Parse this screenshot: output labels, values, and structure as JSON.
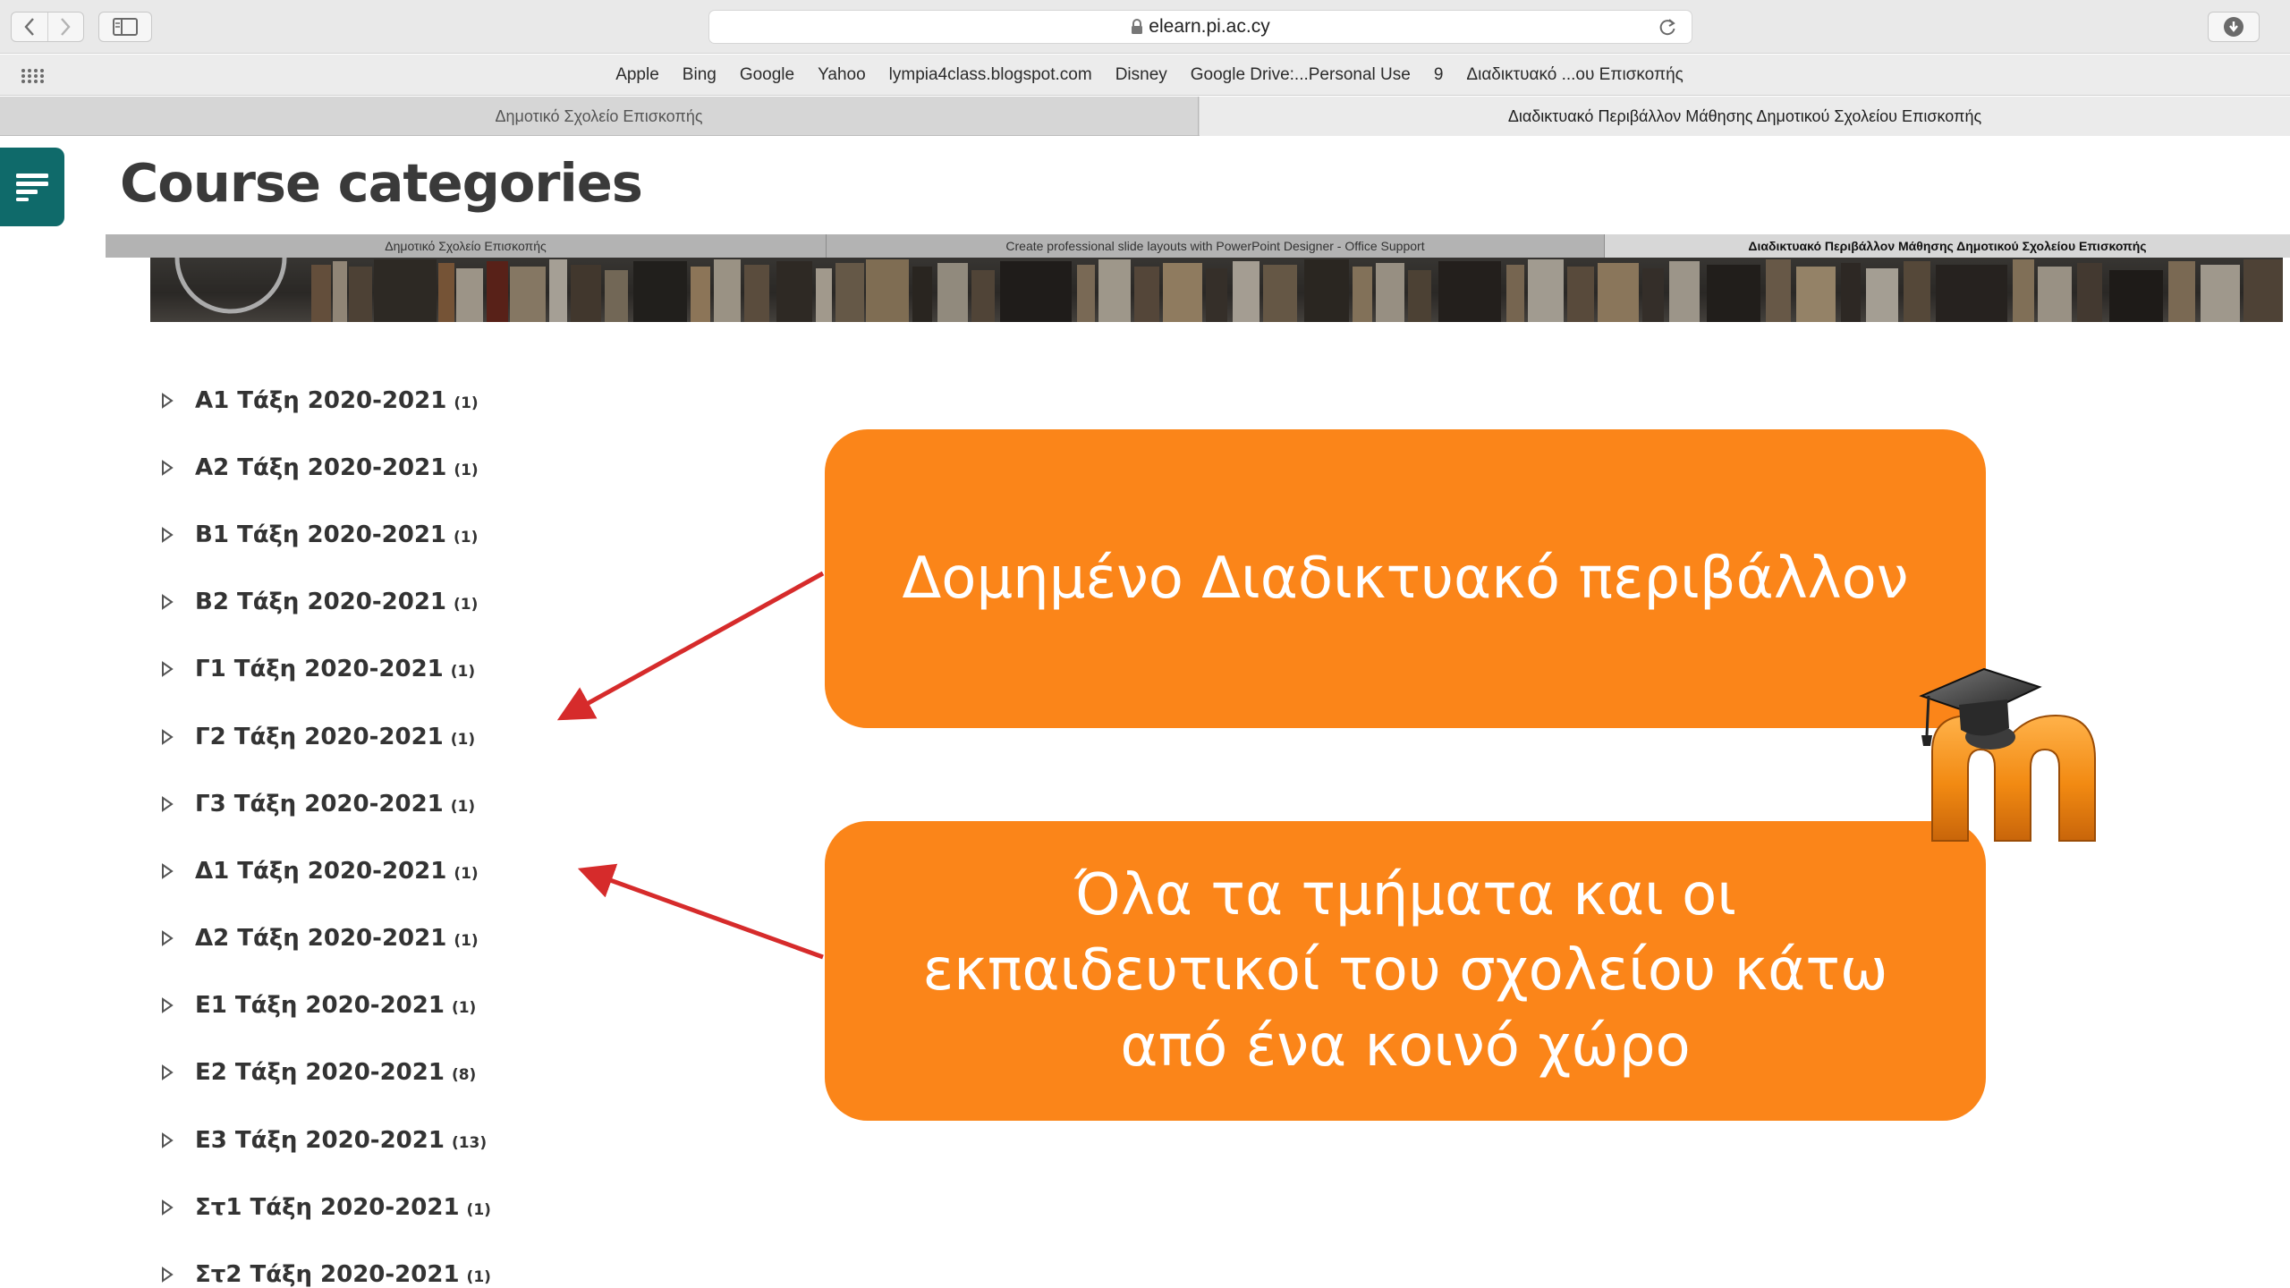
{
  "browser": {
    "url": "elearn.pi.ac.cy",
    "favorites": [
      "Apple",
      "Bing",
      "Google",
      "Yahoo",
      "lympia4class.blogspot.com",
      "Disney",
      "Google Drive:...Personal Use",
      "9",
      "Διαδικτυακό ...ου Επισκοπής"
    ],
    "tabs": [
      "Δημοτικό Σχολείο Επισκοπής",
      "Διαδικτυακό Περιβάλλον Μάθησης Δημοτικού Σχολείου Επισκοπής"
    ]
  },
  "page": {
    "title": "Course categories",
    "inner_tabs": [
      "Δημοτικό Σχολείο Επισκοπής",
      "Create professional slide layouts with PowerPoint Designer - Office Support",
      "Διαδικτυακό Περιβάλλον Μάθησης Δημοτικού Σχολείου Επισκοπής"
    ]
  },
  "categories": [
    {
      "name": "Α1 Τάξη 2020-2021",
      "count": "(1)"
    },
    {
      "name": "Α2 Τάξη 2020-2021",
      "count": "(1)"
    },
    {
      "name": "Β1 Τάξη 2020-2021",
      "count": "(1)"
    },
    {
      "name": "Β2 Τάξη 2020-2021",
      "count": "(1)"
    },
    {
      "name": "Γ1 Τάξη 2020-2021",
      "count": "(1)"
    },
    {
      "name": "Γ2 Τάξη 2020-2021",
      "count": "(1)"
    },
    {
      "name": "Γ3 Τάξη 2020-2021",
      "count": "(1)"
    },
    {
      "name": "Δ1 Τάξη 2020-2021",
      "count": "(1)"
    },
    {
      "name": "Δ2 Τάξη 2020-2021",
      "count": "(1)"
    },
    {
      "name": "Ε1 Τάξη 2020-2021",
      "count": "(1)"
    },
    {
      "name": "Ε2 Τάξη 2020-2021",
      "count": "(8)"
    },
    {
      "name": "Ε3 Τάξη 2020-2021",
      "count": "(13)"
    },
    {
      "name": "Στ1 Τάξη 2020-2021",
      "count": "(1)"
    },
    {
      "name": "Στ2 Τάξη 2020-2021",
      "count": "(1)"
    }
  ],
  "callouts": {
    "first": "Δομημένο Διαδικτυακό περιβάλλον",
    "second": "Όλα τα τμήματα και οι εκπαιδευτικοί του σχολείου κάτω από ένα κοινό χώρο"
  },
  "colors": {
    "callout": "#fb8519",
    "arrow": "#d62b2b",
    "drawer": "#0f6a6a"
  },
  "icons": [
    "chevron-left-icon",
    "chevron-right-icon",
    "sidebar-icon",
    "lock-icon",
    "reload-icon",
    "download-icon",
    "grid-icon",
    "drawer-menu-icon",
    "expand-triangle-icon",
    "moodle-logo"
  ]
}
